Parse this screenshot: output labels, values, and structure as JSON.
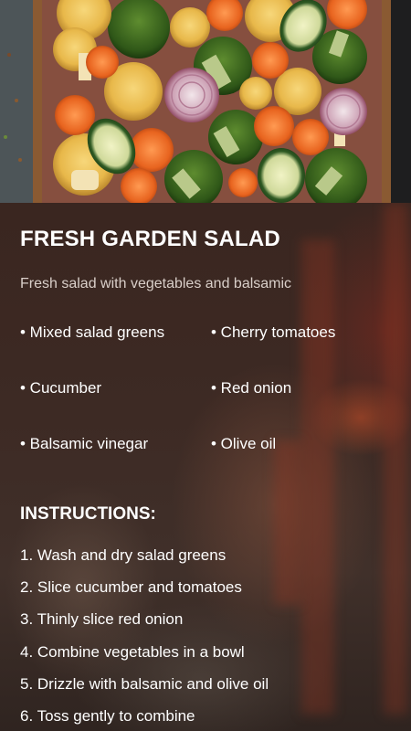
{
  "recipe": {
    "title": "FRESH GARDEN SALAD",
    "description": "Fresh salad with vegetables and balsamic",
    "ingredients": [
      "• Mixed salad greens",
      "• Cherry tomatoes",
      "• Cucumber",
      "• Red onion",
      "• Balsamic vinegar",
      "• Olive oil"
    ],
    "instructions_heading": "INSTRUCTIONS:",
    "steps": [
      "1. Wash and dry salad greens",
      "2. Slice cucumber and tomatoes",
      "3. Thinly slice red onion",
      "4. Combine vegetables in a bowl",
      "5. Drizzle with balsamic and olive oil",
      "6. Toss gently to combine"
    ]
  },
  "colors": {
    "text": "#ffffff",
    "muted_text": "#d9cfc9",
    "background": "#2e201b"
  }
}
